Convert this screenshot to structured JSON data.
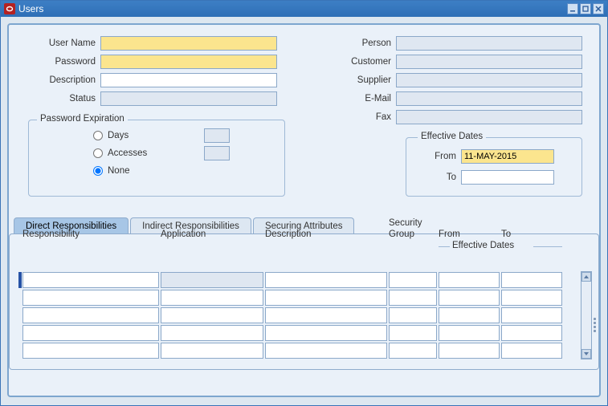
{
  "window": {
    "title": "Users"
  },
  "left_fields": {
    "user_name": {
      "label": "User Name",
      "value": ""
    },
    "password": {
      "label": "Password",
      "value": ""
    },
    "description": {
      "label": "Description",
      "value": ""
    },
    "status": {
      "label": "Status",
      "value": ""
    }
  },
  "right_fields": {
    "person": {
      "label": "Person",
      "value": ""
    },
    "customer": {
      "label": "Customer",
      "value": ""
    },
    "supplier": {
      "label": "Supplier",
      "value": ""
    },
    "email": {
      "label": "E-Mail",
      "value": ""
    },
    "fax": {
      "label": "Fax",
      "value": ""
    }
  },
  "password_expiration": {
    "legend": "Password Expiration",
    "days_label": "Days",
    "accesses_label": "Accesses",
    "none_label": "None",
    "selected": "none",
    "days_value": "",
    "accesses_value": ""
  },
  "effective_dates": {
    "legend": "Effective Dates",
    "from_label": "From",
    "to_label": "To",
    "from_value": "11-MAY-2015",
    "to_value": ""
  },
  "tabs": {
    "direct": "Direct Responsibilities",
    "indirect": "Indirect Responsibilities",
    "securing": "Securing Attributes"
  },
  "grid": {
    "eff_legend": "Effective Dates",
    "headers": {
      "responsibility": "Responsibility",
      "application": "Application",
      "description": "Description",
      "security_group_l1": "Security",
      "security_group_l2": "Group",
      "from": "From",
      "to": "To"
    },
    "rows": [
      {
        "responsibility": "",
        "application": "",
        "description": "",
        "security_group": "",
        "from": "",
        "to": ""
      },
      {
        "responsibility": "",
        "application": "",
        "description": "",
        "security_group": "",
        "from": "",
        "to": ""
      },
      {
        "responsibility": "",
        "application": "",
        "description": "",
        "security_group": "",
        "from": "",
        "to": ""
      },
      {
        "responsibility": "",
        "application": "",
        "description": "",
        "security_group": "",
        "from": "",
        "to": ""
      },
      {
        "responsibility": "",
        "application": "",
        "description": "",
        "security_group": "",
        "from": "",
        "to": ""
      }
    ]
  }
}
